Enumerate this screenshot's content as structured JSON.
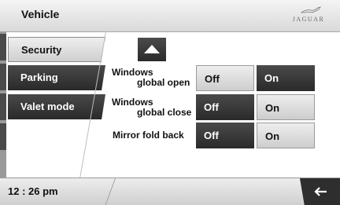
{
  "header": {
    "title": "Vehicle",
    "brand": "JAGUAR"
  },
  "sidebar": {
    "items": [
      {
        "label": "Security",
        "state": "inactive"
      },
      {
        "label": "Parking",
        "state": "active"
      },
      {
        "label": "Valet mode",
        "state": "active"
      }
    ]
  },
  "options": [
    {
      "label_line1": "Windows",
      "label_line2": "global open",
      "off": "Off",
      "on": "On",
      "selected": "on"
    },
    {
      "label_line1": "Windows",
      "label_line2": "global close",
      "off": "Off",
      "on": "On",
      "selected": "off"
    },
    {
      "label_line1": "Mirror fold back",
      "label_line2": "",
      "off": "Off",
      "on": "On",
      "selected": "off"
    }
  ],
  "footer": {
    "clock": "12 : 26 pm"
  },
  "colors": {
    "dark_button": "#2e2e2e",
    "light_button": "#dedede",
    "header": "#e5e5e5"
  },
  "icons": {
    "up": "scroll-up-icon",
    "back": "back-arrow-icon",
    "brand": "jaguar-leaper-icon"
  }
}
